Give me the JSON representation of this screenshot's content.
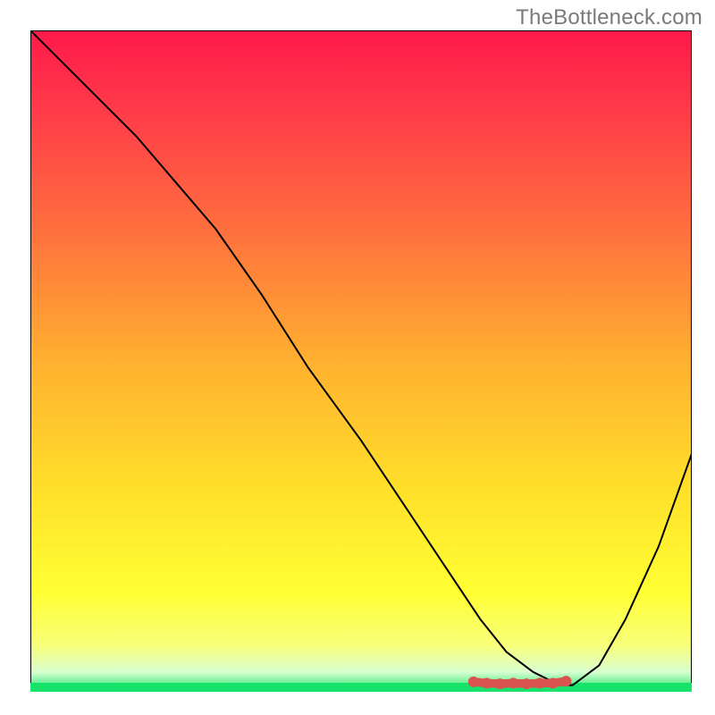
{
  "watermark": "TheBottleneck.com",
  "chart_data": {
    "type": "line",
    "title": "",
    "xlabel": "",
    "ylabel": "",
    "xlim": [
      0,
      100
    ],
    "ylim": [
      0,
      100
    ],
    "background_gradient": [
      {
        "stop": 0.0,
        "color": "#ff1a4a"
      },
      {
        "stop": 0.12,
        "color": "#ff3a49"
      },
      {
        "stop": 0.3,
        "color": "#ff6f3e"
      },
      {
        "stop": 0.5,
        "color": "#ffb02f"
      },
      {
        "stop": 0.7,
        "color": "#ffe12a"
      },
      {
        "stop": 0.85,
        "color": "#ffff33"
      },
      {
        "stop": 0.93,
        "color": "#f8ff7a"
      },
      {
        "stop": 0.97,
        "color": "#d9ffd0"
      },
      {
        "stop": 1.0,
        "color": "#17e36b"
      }
    ],
    "series": [
      {
        "name": "bottleneck-curve",
        "color": "#000000",
        "width": 2,
        "x": [
          0,
          8,
          16,
          22,
          28,
          35,
          42,
          50,
          58,
          64,
          68,
          72,
          76,
          80,
          82,
          86,
          90,
          95,
          100
        ],
        "values": [
          100,
          92,
          84,
          77,
          70,
          60,
          49,
          38,
          26,
          17,
          11,
          6,
          3,
          1,
          1,
          4,
          11,
          22,
          36
        ]
      }
    ],
    "markers": {
      "name": "optimal-range-markers",
      "color": "#d9534f",
      "radius": 6,
      "x": [
        67,
        69,
        71,
        73,
        75,
        77,
        79,
        81
      ],
      "values": [
        1.5,
        1.3,
        1.2,
        1.3,
        1.2,
        1.3,
        1.3,
        1.6
      ]
    }
  }
}
